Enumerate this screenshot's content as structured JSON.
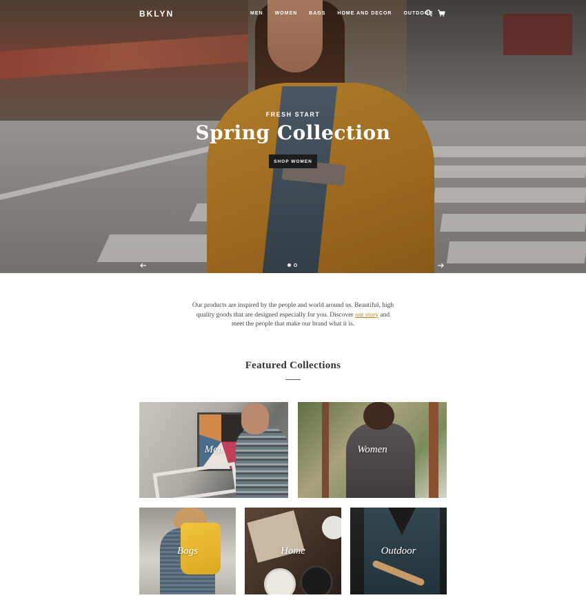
{
  "nav": {
    "logo": "BKLYN",
    "items": [
      "MEN",
      "WOMEN",
      "BAGS",
      "HOME AND DECOR",
      "OUTDOOR"
    ],
    "icons": [
      "search-icon",
      "cart-icon"
    ]
  },
  "hero": {
    "eyebrow": "FRESH START",
    "title": "Spring Collection",
    "button": "SHOP WOMEN",
    "slide_count": 2,
    "active_slide": 1
  },
  "intro": {
    "before": "Our products are inspired by the people and world around us. Beautiful, high quality goods that are designed especially for you. Discover",
    "link": "our story",
    "after": "and meet the people that make our brand what it is."
  },
  "featured": {
    "title": "Featured Collections",
    "collections": [
      "Men",
      "Women",
      "Bags",
      "Home",
      "Outdoor"
    ]
  },
  "colors": {
    "accent_link": "#b8862a",
    "button_bg": "#1d1d1d"
  }
}
